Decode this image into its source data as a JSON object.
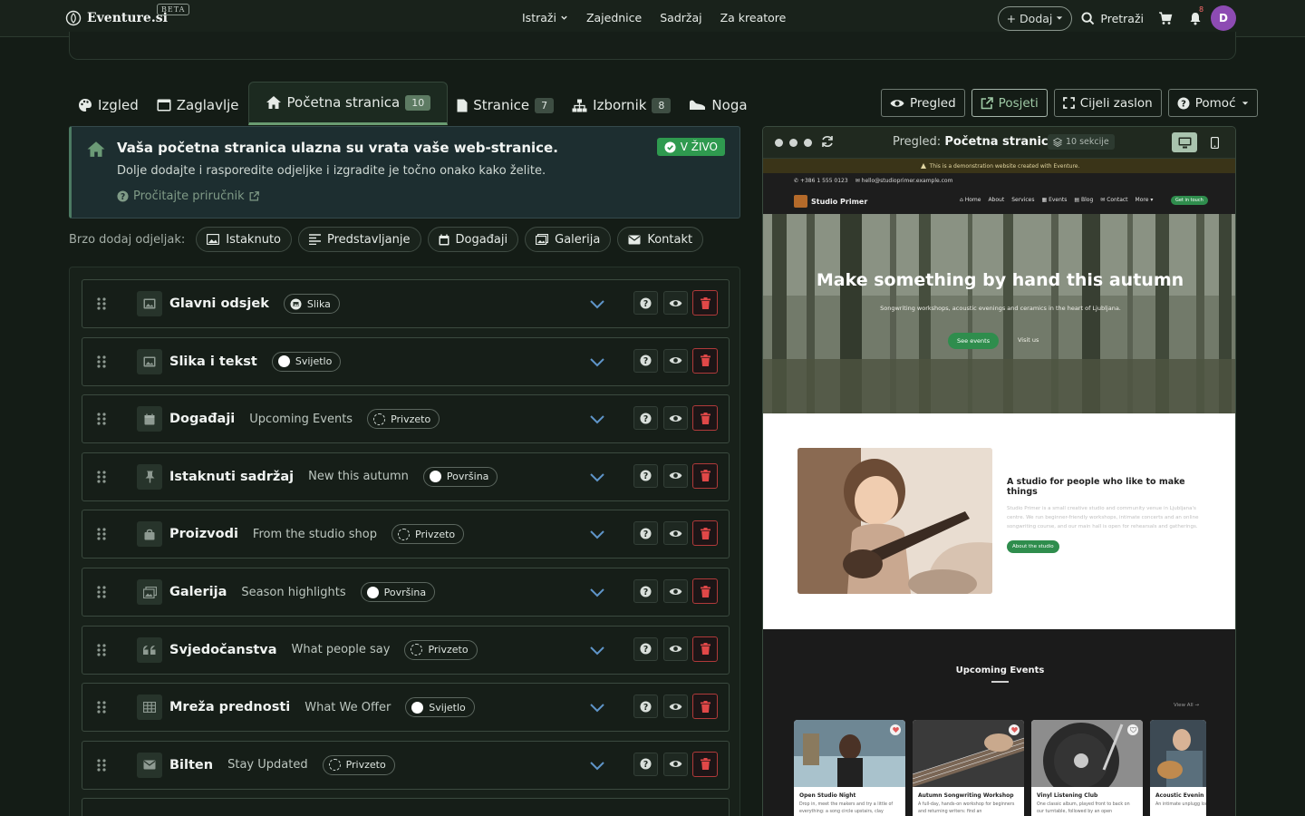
{
  "topnav": {
    "brand": "Eventure.si",
    "beta": "BETA",
    "links": [
      "Istraži",
      "Zajednice",
      "Sadržaj",
      "Za kreatore"
    ],
    "add_label": "+ Dodaj",
    "search_label": "Pretraži",
    "notifications_count": "8",
    "avatar_initial": "D"
  },
  "tabs": [
    {
      "label": "Izgled",
      "icon": "palette-icon"
    },
    {
      "label": "Zaglavlje",
      "icon": "window-icon"
    },
    {
      "label": "Početna stranica",
      "count": "10",
      "icon": "home-icon",
      "active": true
    },
    {
      "label": "Stranice",
      "count": "7",
      "icon": "file-icon"
    },
    {
      "label": "Izbornik",
      "count": "8",
      "icon": "sitemap-icon"
    },
    {
      "label": "Noga",
      "icon": "shoe-icon"
    }
  ],
  "actions": {
    "preview": "Pregled",
    "visit": "Posjeti",
    "fullscreen": "Cijeli zaslon",
    "help": "Pomoć"
  },
  "welcome": {
    "title": "Vaša početna stranica ulazna su vrata vaše web-stranice.",
    "desc": "Dolje dodajte i rasporedite odjeljke i izgradite je točno onako kako želite.",
    "link": "Pročitajte priručnik",
    "live": "V ŽIVO"
  },
  "quick_add": {
    "label": "Brzo dodaj odjeljak:",
    "chips": [
      "Istaknuto",
      "Predstavljanje",
      "Događaji",
      "Galerija",
      "Kontakt"
    ]
  },
  "sections": [
    {
      "title": "Glavni odsjek",
      "subtitle": "",
      "pill": "Slika",
      "pill_style": "image",
      "icon": "image-icon"
    },
    {
      "title": "Slika i tekst",
      "subtitle": "",
      "pill": "Svijetlo",
      "pill_style": "solid",
      "icon": "image-icon"
    },
    {
      "title": "Događaji",
      "subtitle": "Upcoming Events",
      "pill": "Privzeto",
      "pill_style": "dashed",
      "icon": "calendar-icon"
    },
    {
      "title": "Istaknuti sadržaj",
      "subtitle": "New this autumn",
      "pill": "Površina",
      "pill_style": "solid",
      "icon": "pin-icon"
    },
    {
      "title": "Proizvodi",
      "subtitle": "From the studio shop",
      "pill": "Privzeto",
      "pill_style": "dashed",
      "icon": "bag-icon"
    },
    {
      "title": "Galerija",
      "subtitle": "Season highlights",
      "pill": "Površina",
      "pill_style": "solid",
      "icon": "gallery-icon"
    },
    {
      "title": "Svjedočanstva",
      "subtitle": "What people say",
      "pill": "Privzeto",
      "pill_style": "dashed",
      "icon": "quote-icon"
    },
    {
      "title": "Mreža prednosti",
      "subtitle": "What We Offer",
      "pill": "Svijetlo",
      "pill_style": "solid",
      "icon": "grid-icon"
    },
    {
      "title": "Bilten",
      "subtitle": "Stay Updated",
      "pill": "Privzeto",
      "pill_style": "dashed",
      "icon": "envelope-icon"
    }
  ],
  "preview": {
    "label": "Pregled:",
    "page": "Početna stranica",
    "sections_count": "10 sekcije",
    "demo_notice": "This is a demonstration website created with Eventure.",
    "phone": "+386 1 555 0123",
    "email": "hello@studioprimer.example.com",
    "site_name": "Studio Primer",
    "menu": [
      "Home",
      "About",
      "Services",
      "Events",
      "Blog",
      "Contact",
      "More"
    ],
    "cta": "Get in touch",
    "hero_title": "Make something by hand this autumn",
    "hero_sub": "Songwriting workshops, acoustic evenings and ceramics in the heart of Ljubljana.",
    "hero_btn": "See events",
    "hero_btn2": "Visit us",
    "about_title": "A studio for people who like to make things",
    "about_text": "Studio Primer is a small creative studio and community venue in Ljubljana's centre. We run beginner-friendly workshops, intimate concerts and an online songwriting course, and our main hall is open for rehearsals and gatherings.",
    "about_btn": "About the studio",
    "events_title": "Upcoming Events",
    "view_all": "View All →",
    "cards": [
      {
        "title": "Open Studio Night",
        "desc": "Drop in, meet the makers and try a little of everything: a song circle upstairs, clay"
      },
      {
        "title": "Autumn Songwriting Workshop",
        "desc": "A full-day, hands-on workshop for beginners and returning writers: find an"
      },
      {
        "title": "Vinyl Listening Club",
        "desc": "One classic album, played front to back on our turntable, followed by an open"
      },
      {
        "title": "Acoustic Evenin",
        "desc": "An intimate unplugg local songwriters in c"
      }
    ]
  }
}
